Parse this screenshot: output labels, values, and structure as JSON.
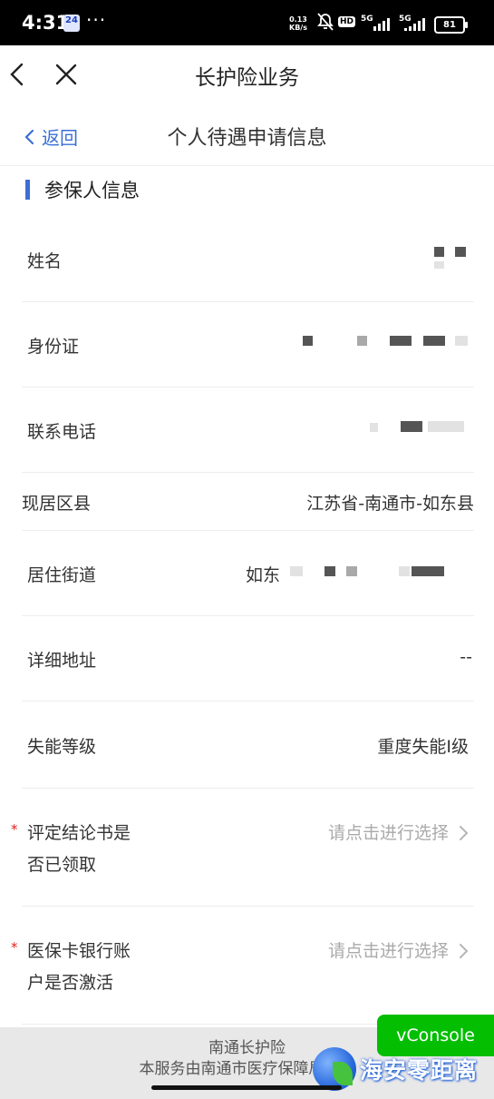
{
  "status_bar": {
    "time": "4:31",
    "calendar_badge": "24",
    "more": "···",
    "net_speed_value": "0.13",
    "net_speed_unit": "KB/s",
    "hd_label": "HD",
    "sim1_label": "5G",
    "sim2_label": "5G",
    "battery": "81"
  },
  "header": {
    "title": "长护险业务"
  },
  "sub_header": {
    "back_label": "返回",
    "title": "个人待遇申请信息"
  },
  "section": {
    "title": "参保人信息"
  },
  "rows": [
    {
      "label": "姓名",
      "value": ""
    },
    {
      "label": "身份证",
      "value": ""
    },
    {
      "label": "联系电话",
      "value": ""
    },
    {
      "label": "现居区县",
      "value": "江苏省-南通市-如东县"
    },
    {
      "label": "居住街道",
      "value": "如东"
    },
    {
      "label": "详细地址",
      "value": "--"
    },
    {
      "label": "失能等级",
      "value": "重度失能I级"
    },
    {
      "label_line1": "评定结论书是",
      "label_line2": "否已领取",
      "placeholder": "请点击进行选择",
      "required_mark": "*"
    },
    {
      "label_line1": "医保卡银行账",
      "label_line2": "户是否激活",
      "placeholder": "请点击进行选择",
      "required_mark": "*"
    }
  ],
  "footer": {
    "line1": "南通长护险",
    "line2": "本服务由南通市医疗保障局提供"
  },
  "vconsole": {
    "label": "vConsole"
  },
  "watermark": {
    "text": "海安零距离"
  },
  "colors": {
    "accent": "#3b6fd6",
    "required": "#e02020",
    "vconsole": "#04be02"
  }
}
